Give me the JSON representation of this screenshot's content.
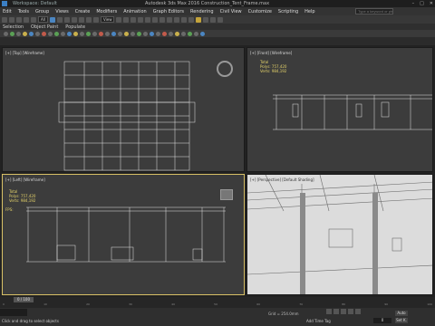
{
  "title_bar": {
    "workspace": "Workspace: Default",
    "title": "Autodesk 3ds Max 2016   Construction_Tent_Frame.max",
    "window_buttons": [
      "–",
      "□",
      "✕"
    ]
  },
  "menu": {
    "items": [
      "Edit",
      "Tools",
      "Group",
      "Views",
      "Create",
      "Modifiers",
      "Animation",
      "Graph Editors",
      "Rendering",
      "Civil View",
      "Customize",
      "Scripting",
      "Help"
    ],
    "search_placeholder": "Type a keyword or phrase"
  },
  "toolbar": {
    "filter": "All",
    "view": "View"
  },
  "ribbon_tabs": [
    "Selection",
    "Object Paint",
    "Populate"
  ],
  "viewports": [
    {
      "label": "[+] [Top] [Wireframe]",
      "active": false
    },
    {
      "label": "[+] [Front] [Wireframe]",
      "active": false
    },
    {
      "label": "[+] [Left] [Wireframe]",
      "active": true
    },
    {
      "label": "[+] [Perspective] [Default Shading]",
      "active": false
    }
  ],
  "stats": {
    "heading": "Total",
    "polys_label": "Polys:",
    "polys": "757,420",
    "verts_label": "Verts:",
    "verts": "984,192",
    "fps_label": "FPS:"
  },
  "timeline": {
    "slider": "0 / 100",
    "ticks": [
      "0",
      "5",
      "10",
      "15",
      "20",
      "25",
      "30",
      "35",
      "40",
      "45",
      "50",
      "55",
      "60",
      "65",
      "70",
      "75",
      "80",
      "85",
      "90",
      "95",
      "100"
    ]
  },
  "status": {
    "message": "Click and drag to select objects",
    "grid": "Grid = 254.0mm",
    "add_time_tag": "Add Time Tag",
    "auto_key": "Auto",
    "set_key": "Set K.",
    "selected": "Selected",
    "frame": "0"
  }
}
